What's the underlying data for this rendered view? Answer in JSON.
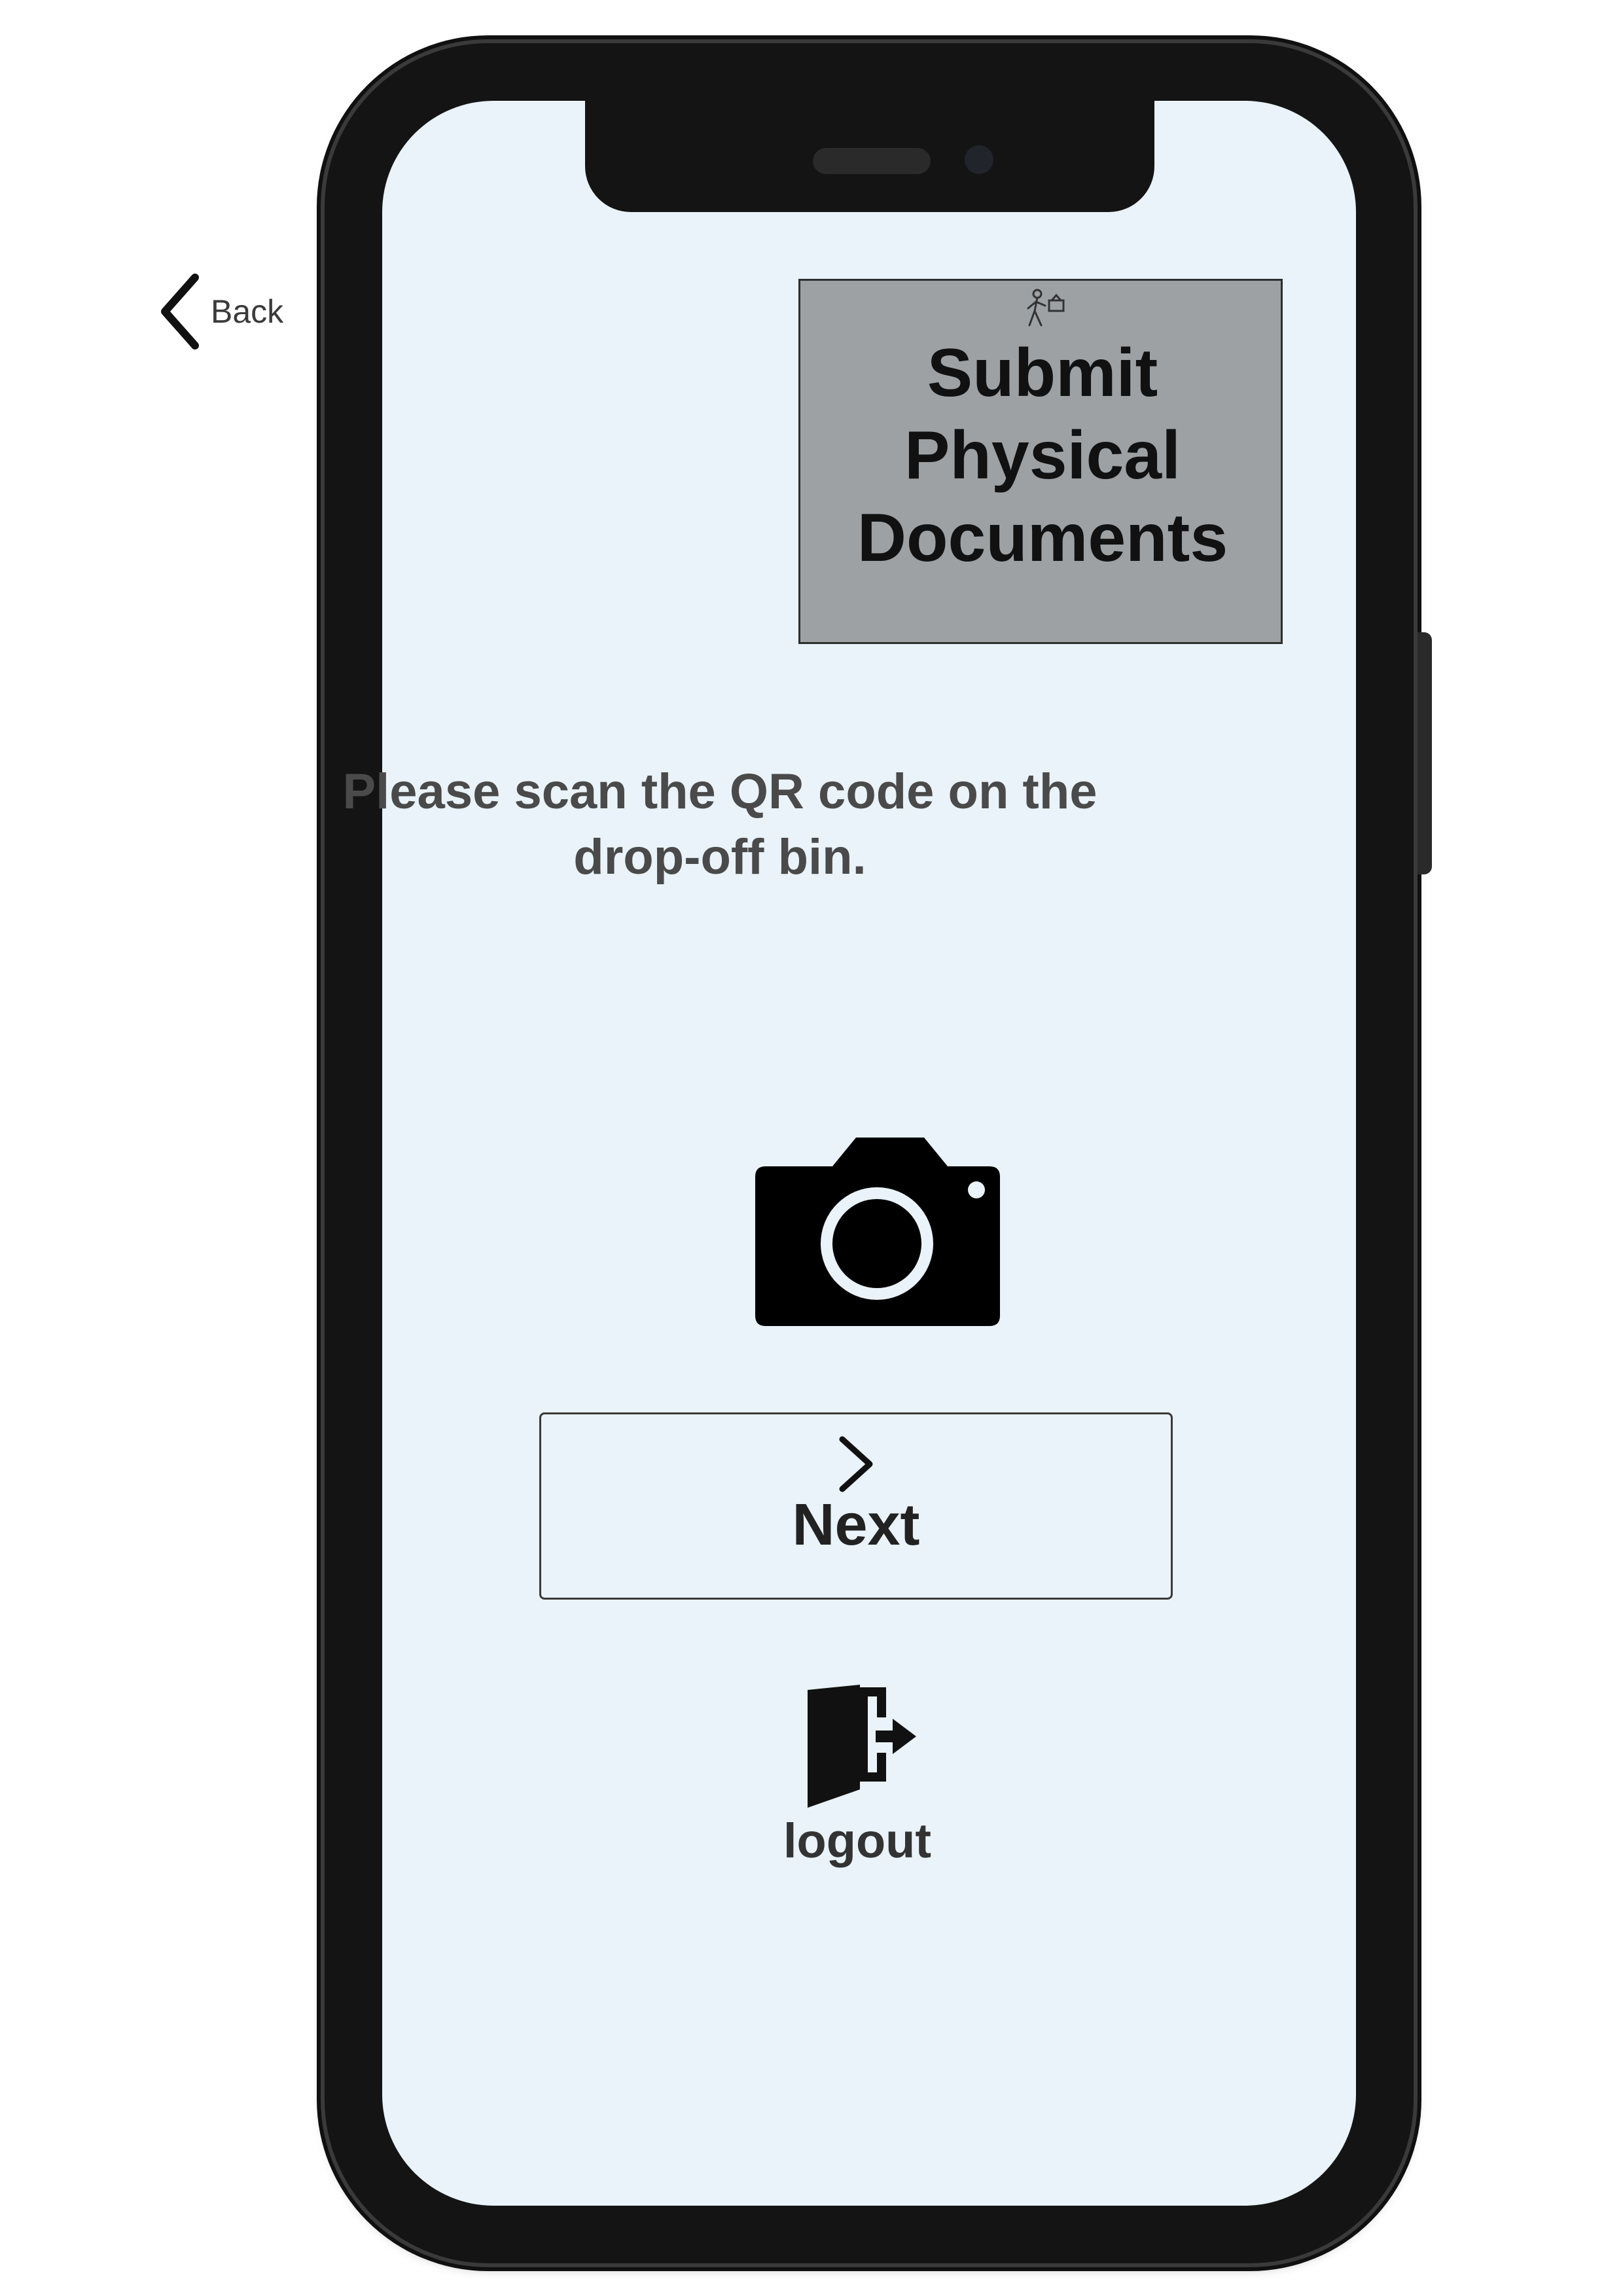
{
  "header": {
    "back_label": "Back",
    "title": "Submit\nPhysical\nDocuments",
    "title_icon": "walking-person-document-icon"
  },
  "main": {
    "instruction": "Please scan the QR code on the\ndrop-off bin.",
    "camera_icon": "camera-icon"
  },
  "actions": {
    "next_label": "Next",
    "next_icon": "chevron-right-icon",
    "logout_label": "logout",
    "logout_icon": "logout-door-icon"
  },
  "colors": {
    "screen_background": "#e9f3f9",
    "title_box_background": "#9da1a4",
    "phone_frame": "#141414"
  }
}
